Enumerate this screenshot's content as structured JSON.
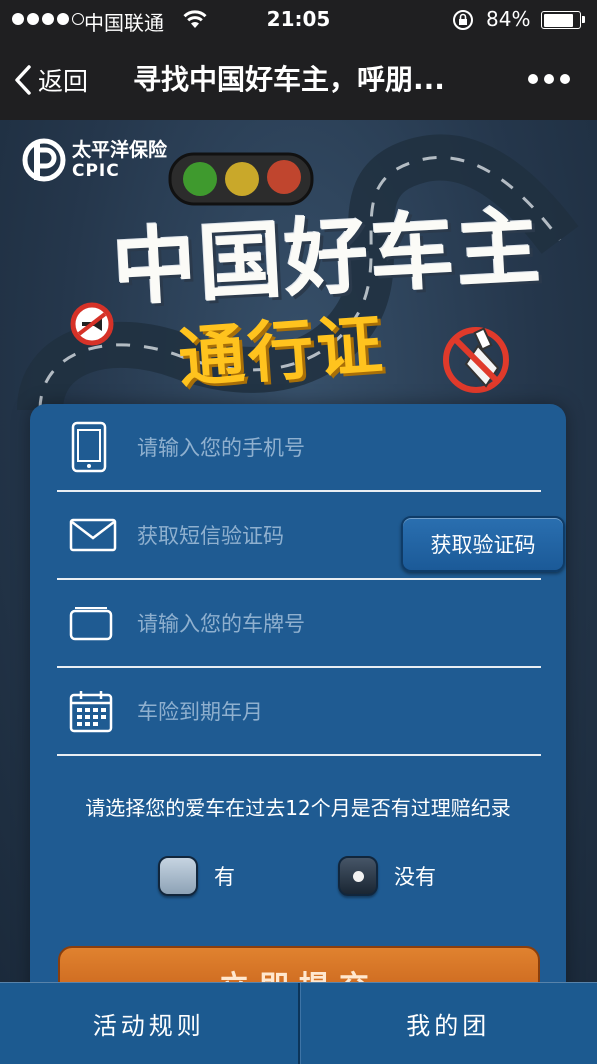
{
  "status_bar": {
    "carrier": "中国联通",
    "time": "21:05",
    "battery_percent": "84%",
    "battery_level": 0.84,
    "signal_bars_filled": 4,
    "signal_bars_total": 5
  },
  "nav": {
    "back_label": "返回",
    "title": "寻找中国好车主，呼朋..."
  },
  "banner": {
    "logo_cn": "太平洋保险",
    "logo_en": "CPIC",
    "headline": "中国好车主",
    "subhead": "通行证",
    "colors": {
      "headline": "#fbfbf7",
      "subhead": "#ffc31e"
    }
  },
  "form": {
    "phone_placeholder": "请输入您的手机号",
    "sms_code_placeholder": "获取短信验证码",
    "get_code_button": "获取验证码",
    "plate_placeholder": "请输入您的车牌号",
    "expiry_placeholder": "车险到期年月",
    "claim_question": "请选择您的爱车在过去12个月是否有过理赔纪录",
    "option_yes": "有",
    "option_no": "没有",
    "selected_option": "没有",
    "submit_label": "立即提交"
  },
  "bottom_bar": {
    "tabs": [
      {
        "label": "活动规则"
      },
      {
        "label": "我的团"
      }
    ]
  },
  "icons": [
    "back-chevron-icon",
    "more-dots-icon",
    "wifi-icon",
    "rotation-lock-icon",
    "phone-icon",
    "envelope-icon",
    "card-icon",
    "calendar-icon",
    "traffic-light-icon",
    "no-honking-icon",
    "no-drinking-icon"
  ]
}
